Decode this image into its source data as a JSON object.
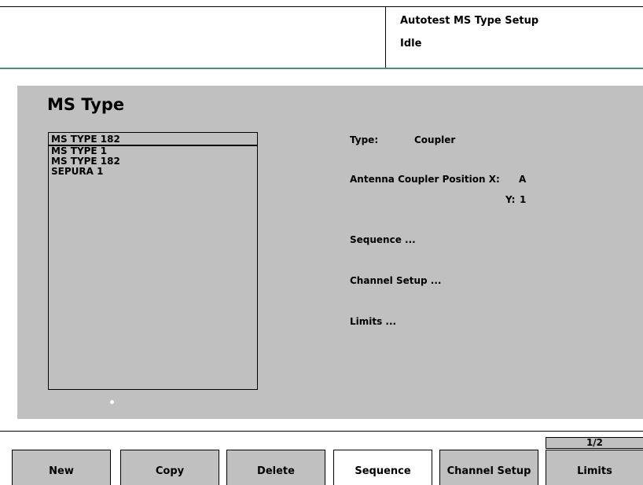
{
  "header": {
    "title": "Autotest MS Type Setup",
    "status": "Idle"
  },
  "panel": {
    "title": "MS Type",
    "selected": "MS TYPE 182",
    "list": [
      "MS TYPE 1",
      "MS TYPE 182",
      "SEPURA 1"
    ],
    "type_label": "Type:",
    "type_value": "Coupler",
    "antenna_label": "Antenna Coupler Position X:",
    "antenna_x": "A",
    "antenna_y_label": "Y:",
    "antenna_y": "1",
    "sequence_link": "Sequence ...",
    "channel_setup_link": "Channel Setup ...",
    "limits_link": "Limits ..."
  },
  "page_indicator": "1/2",
  "softkeys": {
    "new": "New",
    "copy": "Copy",
    "delete": "Delete",
    "sequence": "Sequence",
    "channel_setup": "Channel Setup",
    "limits": "Limits"
  },
  "active_softkey": "Sequence"
}
